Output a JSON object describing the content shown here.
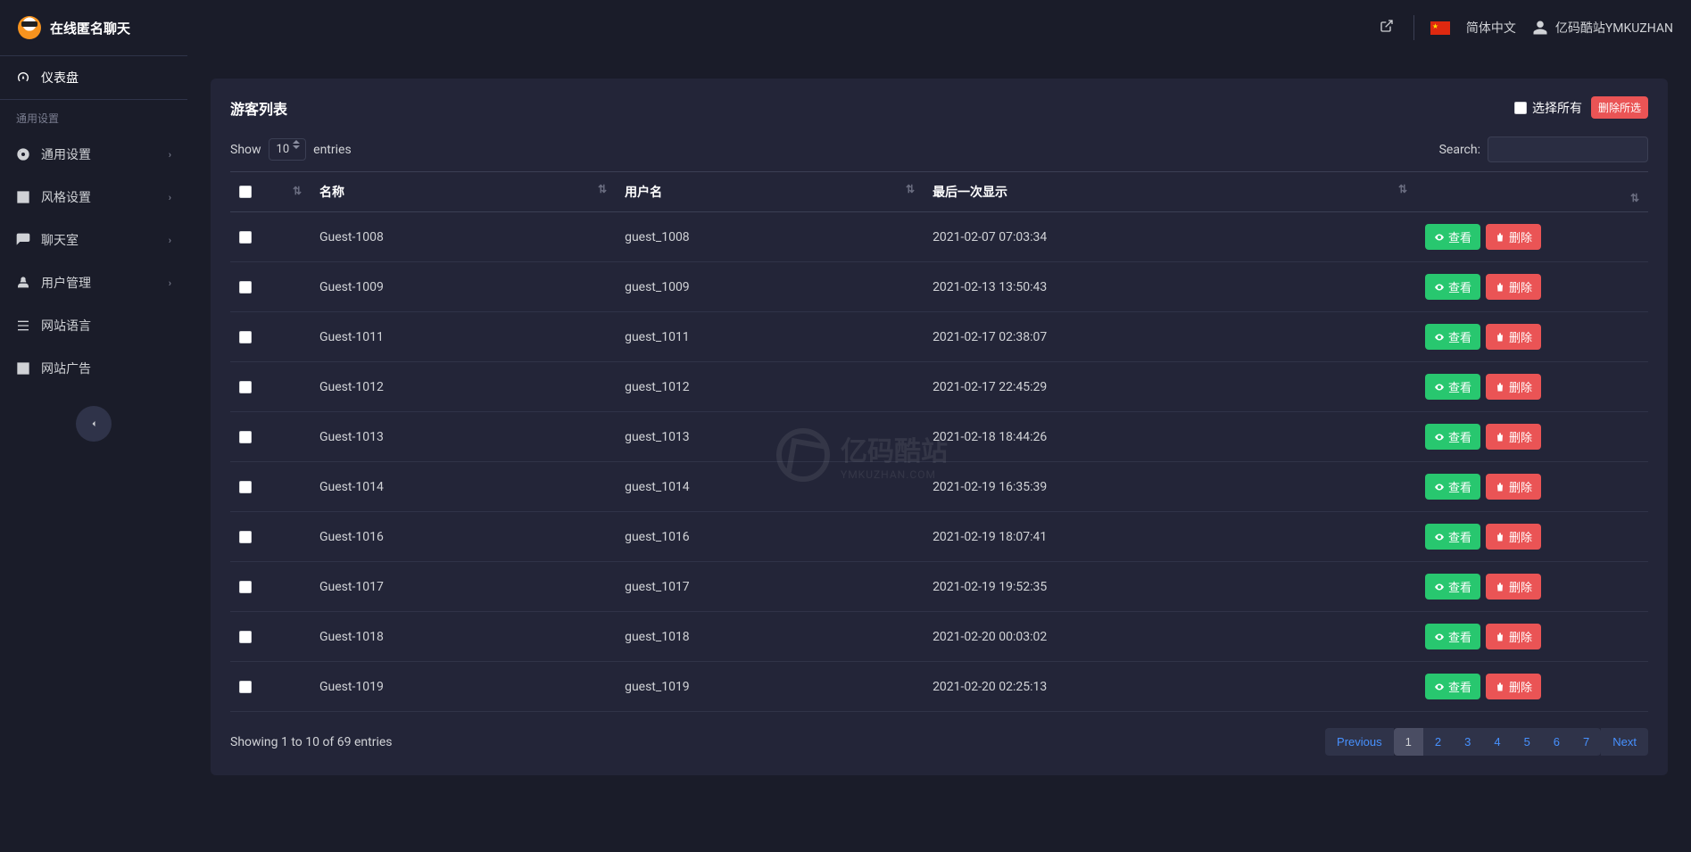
{
  "brand": {
    "title": "在线匿名聊天"
  },
  "topbar": {
    "language_label": "简体中文",
    "username": "亿码酷站YMKUZHAN"
  },
  "sidebar": {
    "dashboard": "仪表盘",
    "section_general": "通用设置",
    "items": [
      {
        "label": "通用设置",
        "expandable": true
      },
      {
        "label": "风格设置",
        "expandable": true
      },
      {
        "label": "聊天室",
        "expandable": true
      },
      {
        "label": "用户管理",
        "expandable": true
      },
      {
        "label": "网站语言",
        "expandable": false
      },
      {
        "label": "网站广告",
        "expandable": false
      }
    ]
  },
  "card": {
    "title": "游客列表",
    "select_all_label": "选择所有",
    "delete_selected_label": "删除所选"
  },
  "table_controls": {
    "show_label": "Show",
    "entries_label": "entries",
    "page_length": "10",
    "search_label": "Search:"
  },
  "columns": {
    "name": "名称",
    "username": "用户名",
    "last_seen": "最后一次显示"
  },
  "actions": {
    "view": "查看",
    "delete": "删除"
  },
  "rows": [
    {
      "name": "Guest-1008",
      "username": "guest_1008",
      "last_seen": "2021-02-07 07:03:34"
    },
    {
      "name": "Guest-1009",
      "username": "guest_1009",
      "last_seen": "2021-02-13 13:50:43"
    },
    {
      "name": "Guest-1011",
      "username": "guest_1011",
      "last_seen": "2021-02-17 02:38:07"
    },
    {
      "name": "Guest-1012",
      "username": "guest_1012",
      "last_seen": "2021-02-17 22:45:29"
    },
    {
      "name": "Guest-1013",
      "username": "guest_1013",
      "last_seen": "2021-02-18 18:44:26"
    },
    {
      "name": "Guest-1014",
      "username": "guest_1014",
      "last_seen": "2021-02-19 16:35:39"
    },
    {
      "name": "Guest-1016",
      "username": "guest_1016",
      "last_seen": "2021-02-19 18:07:41"
    },
    {
      "name": "Guest-1017",
      "username": "guest_1017",
      "last_seen": "2021-02-19 19:52:35"
    },
    {
      "name": "Guest-1018",
      "username": "guest_1018",
      "last_seen": "2021-02-20 00:03:02"
    },
    {
      "name": "Guest-1019",
      "username": "guest_1019",
      "last_seen": "2021-02-20 02:25:13"
    }
  ],
  "footer": {
    "info": "Showing 1 to 10 of 69 entries",
    "prev": "Previous",
    "next": "Next",
    "pages": [
      "1",
      "2",
      "3",
      "4",
      "5",
      "6",
      "7"
    ],
    "active_page": "1"
  },
  "watermark": {
    "main": "亿码酷站",
    "sub": "YMKUZHAN.COM"
  }
}
